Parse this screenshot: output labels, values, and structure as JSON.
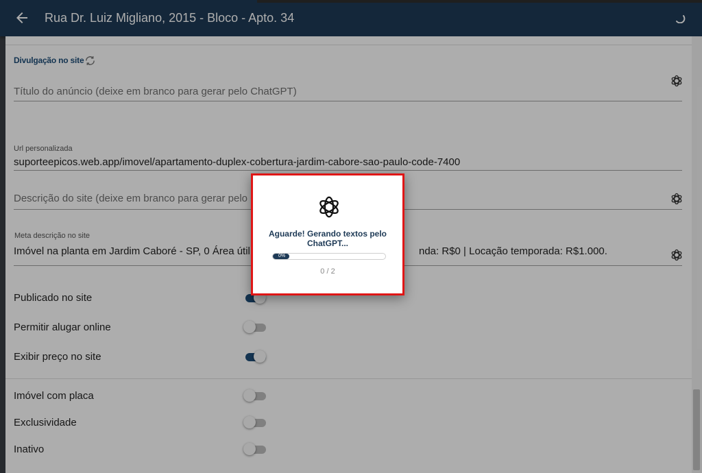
{
  "header": {
    "title": "Rua Dr. Luiz Migliano, 2015 - Bloco - Apto. 34"
  },
  "section": {
    "label": "Divulgação no site"
  },
  "fields": {
    "ad_title": {
      "placeholder": "Título do anúncio (deixe em branco para gerar pelo ChatGPT)"
    },
    "custom_url": {
      "label": "Url personalizada",
      "value": "suporteepicos.web.app/imovel/apartamento-duplex-cobertura-jardim-cabore-sao-paulo-code-7400"
    },
    "site_description": {
      "placeholder": "Descrição do site (deixe em branco para gerar pelo ChatG"
    },
    "meta_description": {
      "label": "Meta descrição no site",
      "value_left": "Imóvel na planta em Jardim Caboré - SP, 0 Área útil, 0 D",
      "value_right": "nda: R$0 | Locação temporada: R$1.000."
    }
  },
  "toggles": [
    {
      "label": "Publicado no site",
      "on": true
    },
    {
      "label": "Permitir alugar online",
      "on": false
    },
    {
      "label": "Exibir preço no site",
      "on": true
    },
    {
      "label": "Imóvel com placa",
      "on": false
    },
    {
      "label": "Exclusividade",
      "on": false
    },
    {
      "label": "Inativo",
      "on": false
    }
  ],
  "dialog": {
    "message": "Aguarde! Gerando textos pelo ChatGPT...",
    "progress_label": "0%",
    "progress": 0,
    "count": "0 / 2"
  },
  "icons": {
    "back": "arrow-left-icon",
    "sync": "sync-icon",
    "chatgpt": "openai-logo-icon",
    "loading": "spinner-icon"
  },
  "colors": {
    "header_bg": "#1e3a56",
    "accent": "#1e4d78",
    "dialog_border": "#e01616"
  }
}
